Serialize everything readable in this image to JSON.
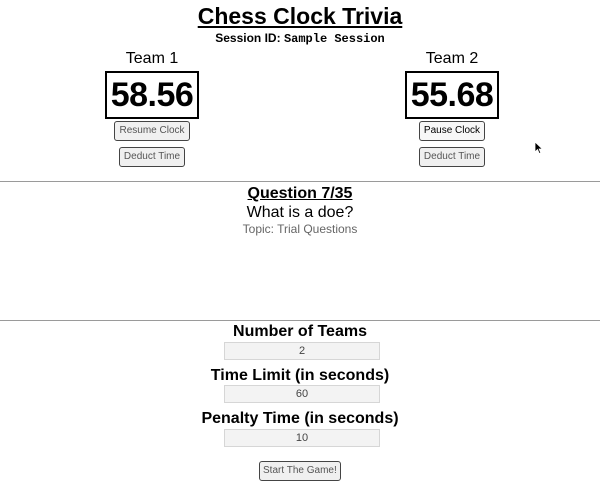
{
  "app": {
    "title": "Chess Clock Trivia",
    "session_label": "Session ID:",
    "session_id": "Sample Session"
  },
  "teams": [
    {
      "name": "Team 1",
      "time": "58.56",
      "clock_button": "Resume Clock",
      "deduct_button": "Deduct Time"
    },
    {
      "name": "Team 2",
      "time": "55.68",
      "clock_button": "Pause Clock",
      "deduct_button": "Deduct Time"
    }
  ],
  "question": {
    "number_label": "Question 7/35",
    "text": "What is a doe?",
    "topic": "Topic: Trial Questions"
  },
  "settings": {
    "num_teams_label": "Number of Teams",
    "num_teams_value": "2",
    "time_limit_label": "Time Limit (in seconds)",
    "time_limit_value": "60",
    "penalty_label": "Penalty Time (in seconds)",
    "penalty_value": "10",
    "start_button": "Start The Game!"
  },
  "icons": {
    "cursor": "mouse-pointer-icon"
  }
}
